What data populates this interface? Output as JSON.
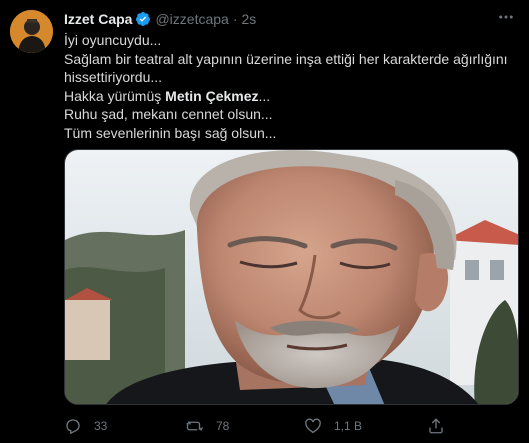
{
  "tweet": {
    "author_name": "Izzet Capa",
    "handle": "@izzetcapa",
    "separator": "·",
    "time": "2s",
    "lines": [
      "İyi oyuncuydu...",
      "Sağlam bir teatral alt yapının üzerine inşa ettiği her karakterde ağırlığını",
      "hissettiriyordu...",
      "Ruhu şad, mekanı cennet olsun...",
      "Tüm sevenlerinin başı sağ olsun..."
    ],
    "line4_prefix": "Hakka yürümüş ",
    "line4_bold": "Metin Çekmez",
    "line4_suffix": "...",
    "actions": {
      "reply_count": "33",
      "retweet_count": "78",
      "like_count": "1,1 B"
    }
  },
  "colors": {
    "background": "#000000",
    "text": "#d9d9d9",
    "muted": "#6e767d",
    "verified_badge": "#1d9bf0"
  },
  "icons": [
    "avatar",
    "verified-badge-icon",
    "more-icon",
    "reply-icon",
    "retweet-icon",
    "like-icon",
    "share-icon"
  ]
}
